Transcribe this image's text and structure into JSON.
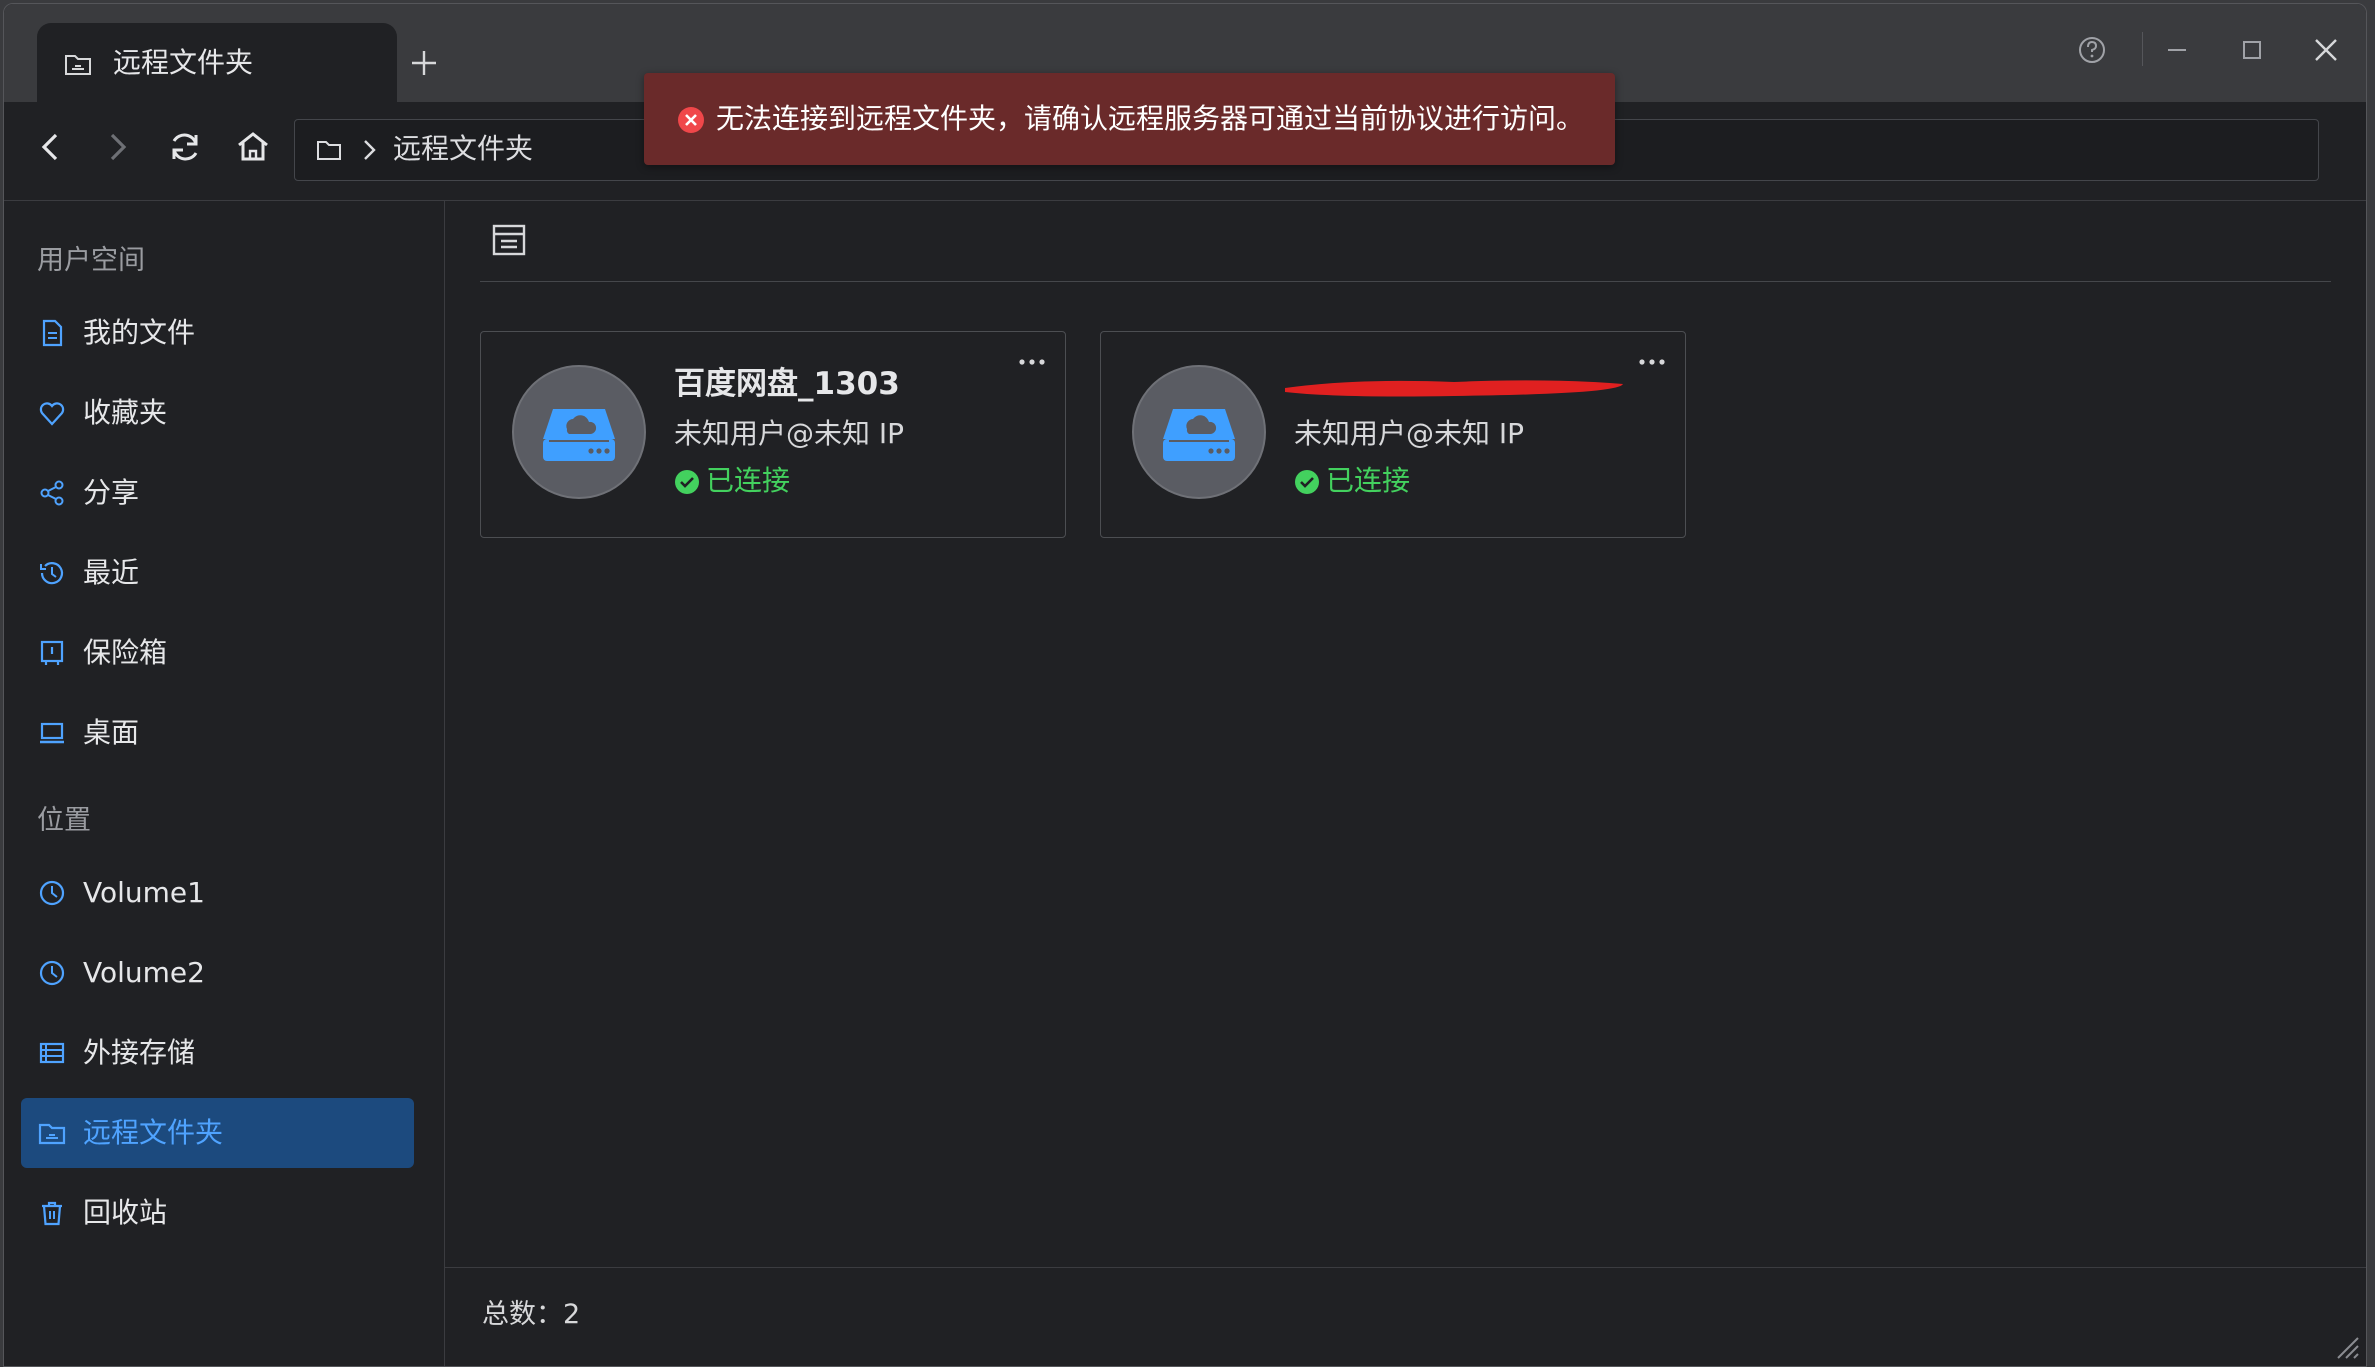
{
  "window": {
    "tab_title": "远程文件夹",
    "icons": {
      "tab": "folder-network-icon",
      "new_tab": "plus-icon",
      "help": "help-icon",
      "minimize": "minimize-icon",
      "maximize": "maximize-icon",
      "close": "close-icon"
    }
  },
  "navbar": {
    "breadcrumb_label": "远程文件夹",
    "icons": {
      "back": "back-icon",
      "forward": "forward-icon",
      "refresh": "refresh-icon",
      "home": "home-icon"
    }
  },
  "toast": {
    "message": "无法连接到远程文件夹，请确认远程服务器可通过当前协议进行访问。",
    "color": "#6a2a2a"
  },
  "sidebar": {
    "user_space_title": "用户空间",
    "user_items": [
      {
        "label": "我的文件",
        "icon": "document-icon"
      },
      {
        "label": "收藏夹",
        "icon": "heart-icon"
      },
      {
        "label": "分享",
        "icon": "share-icon"
      },
      {
        "label": "最近",
        "icon": "history-icon"
      },
      {
        "label": "保险箱",
        "icon": "safe-icon"
      },
      {
        "label": "桌面",
        "icon": "desktop-icon"
      }
    ],
    "location_title": "位置",
    "location_items": [
      {
        "label": "Volume1",
        "icon": "volume-icon"
      },
      {
        "label": "Volume2",
        "icon": "volume-icon"
      },
      {
        "label": "外接存储",
        "icon": "storage-icon"
      },
      {
        "label": "远程文件夹",
        "icon": "folder-network-icon",
        "active": true
      },
      {
        "label": "回收站",
        "icon": "trash-icon"
      }
    ],
    "accent_color": "#4fa3ff"
  },
  "main": {
    "cards": [
      {
        "name": "百度网盘_1303",
        "user": "未知用户@未知 IP",
        "status": "已连接"
      },
      {
        "name": "",
        "user": "未知用户@未知 IP",
        "status": "已连接",
        "name_redacted": true
      }
    ],
    "total_label": "总数：2",
    "status_color": "#43d15e"
  }
}
